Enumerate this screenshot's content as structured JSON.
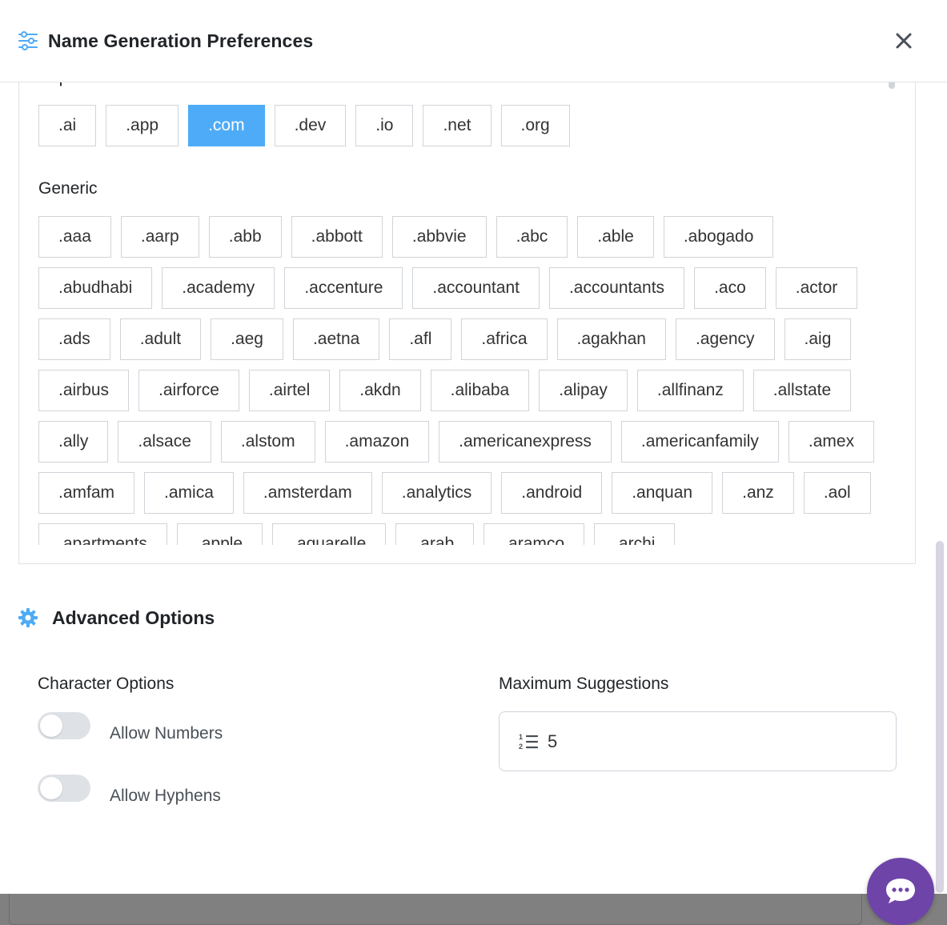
{
  "header": {
    "title": "Name Generation Preferences",
    "icon": "sliders-icon",
    "close_icon": "close-icon"
  },
  "tld": {
    "popular": {
      "title": "Popular",
      "items": [
        ".ai",
        ".app",
        ".com",
        ".dev",
        ".io",
        ".net",
        ".org"
      ],
      "selected": ".com"
    },
    "generic": {
      "title": "Generic",
      "items": [
        ".aaa",
        ".aarp",
        ".abb",
        ".abbott",
        ".abbvie",
        ".abc",
        ".able",
        ".abogado",
        ".abudhabi",
        ".academy",
        ".accenture",
        ".accountant",
        ".accountants",
        ".aco",
        ".actor",
        ".ads",
        ".adult",
        ".aeg",
        ".aetna",
        ".afl",
        ".africa",
        ".agakhan",
        ".agency",
        ".aig",
        ".airbus",
        ".airforce",
        ".airtel",
        ".akdn",
        ".alibaba",
        ".alipay",
        ".allfinanz",
        ".allstate",
        ".ally",
        ".alsace",
        ".alstom",
        ".amazon",
        ".americanexpress",
        ".americanfamily",
        ".amex",
        ".amfam",
        ".amica",
        ".amsterdam",
        ".analytics",
        ".android",
        ".anquan",
        ".anz",
        ".aol",
        ".apartments",
        ".apple",
        ".aquarelle",
        ".arab",
        ".aramco",
        ".archi"
      ]
    }
  },
  "advanced": {
    "title": "Advanced Options",
    "icon": "gear-icon",
    "character_options": {
      "label": "Character Options",
      "allow_numbers": {
        "label": "Allow Numbers",
        "on": false
      },
      "allow_hyphens": {
        "label": "Allow Hyphens",
        "on": false
      }
    },
    "max_suggestions": {
      "label": "Maximum Suggestions",
      "value": "5",
      "icon": "numbered-list-icon"
    }
  },
  "colors": {
    "accent": "#4dabf7",
    "chat": "#6e44a8",
    "toggle_off": "#dee2e6"
  },
  "chat": {
    "icon": "chat-bubble-icon"
  }
}
